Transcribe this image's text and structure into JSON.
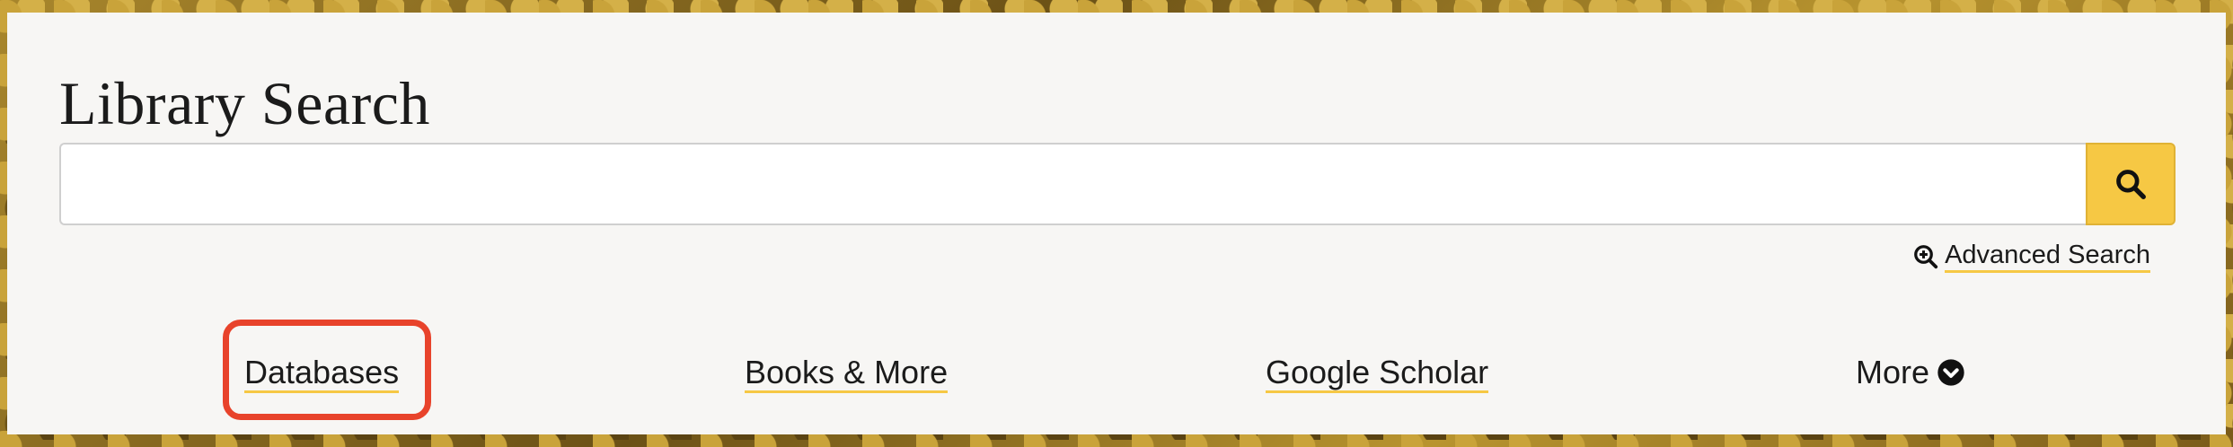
{
  "panel": {
    "title": "Library Search",
    "search": {
      "value": "",
      "placeholder": ""
    },
    "advanced_search_label": "Advanced Search",
    "nav": {
      "databases": "Databases",
      "books_more": "Books & More",
      "google_scholar": "Google Scholar",
      "more": "More"
    }
  },
  "colors": {
    "accent": "#f6c844",
    "highlight_box": "#e8432b",
    "panel_bg": "#f7f6f4",
    "text": "#1b1b1b"
  },
  "icons": {
    "search_button": "search-icon",
    "advanced_search": "zoom-in-icon",
    "more": "chevron-down-circle-icon"
  }
}
